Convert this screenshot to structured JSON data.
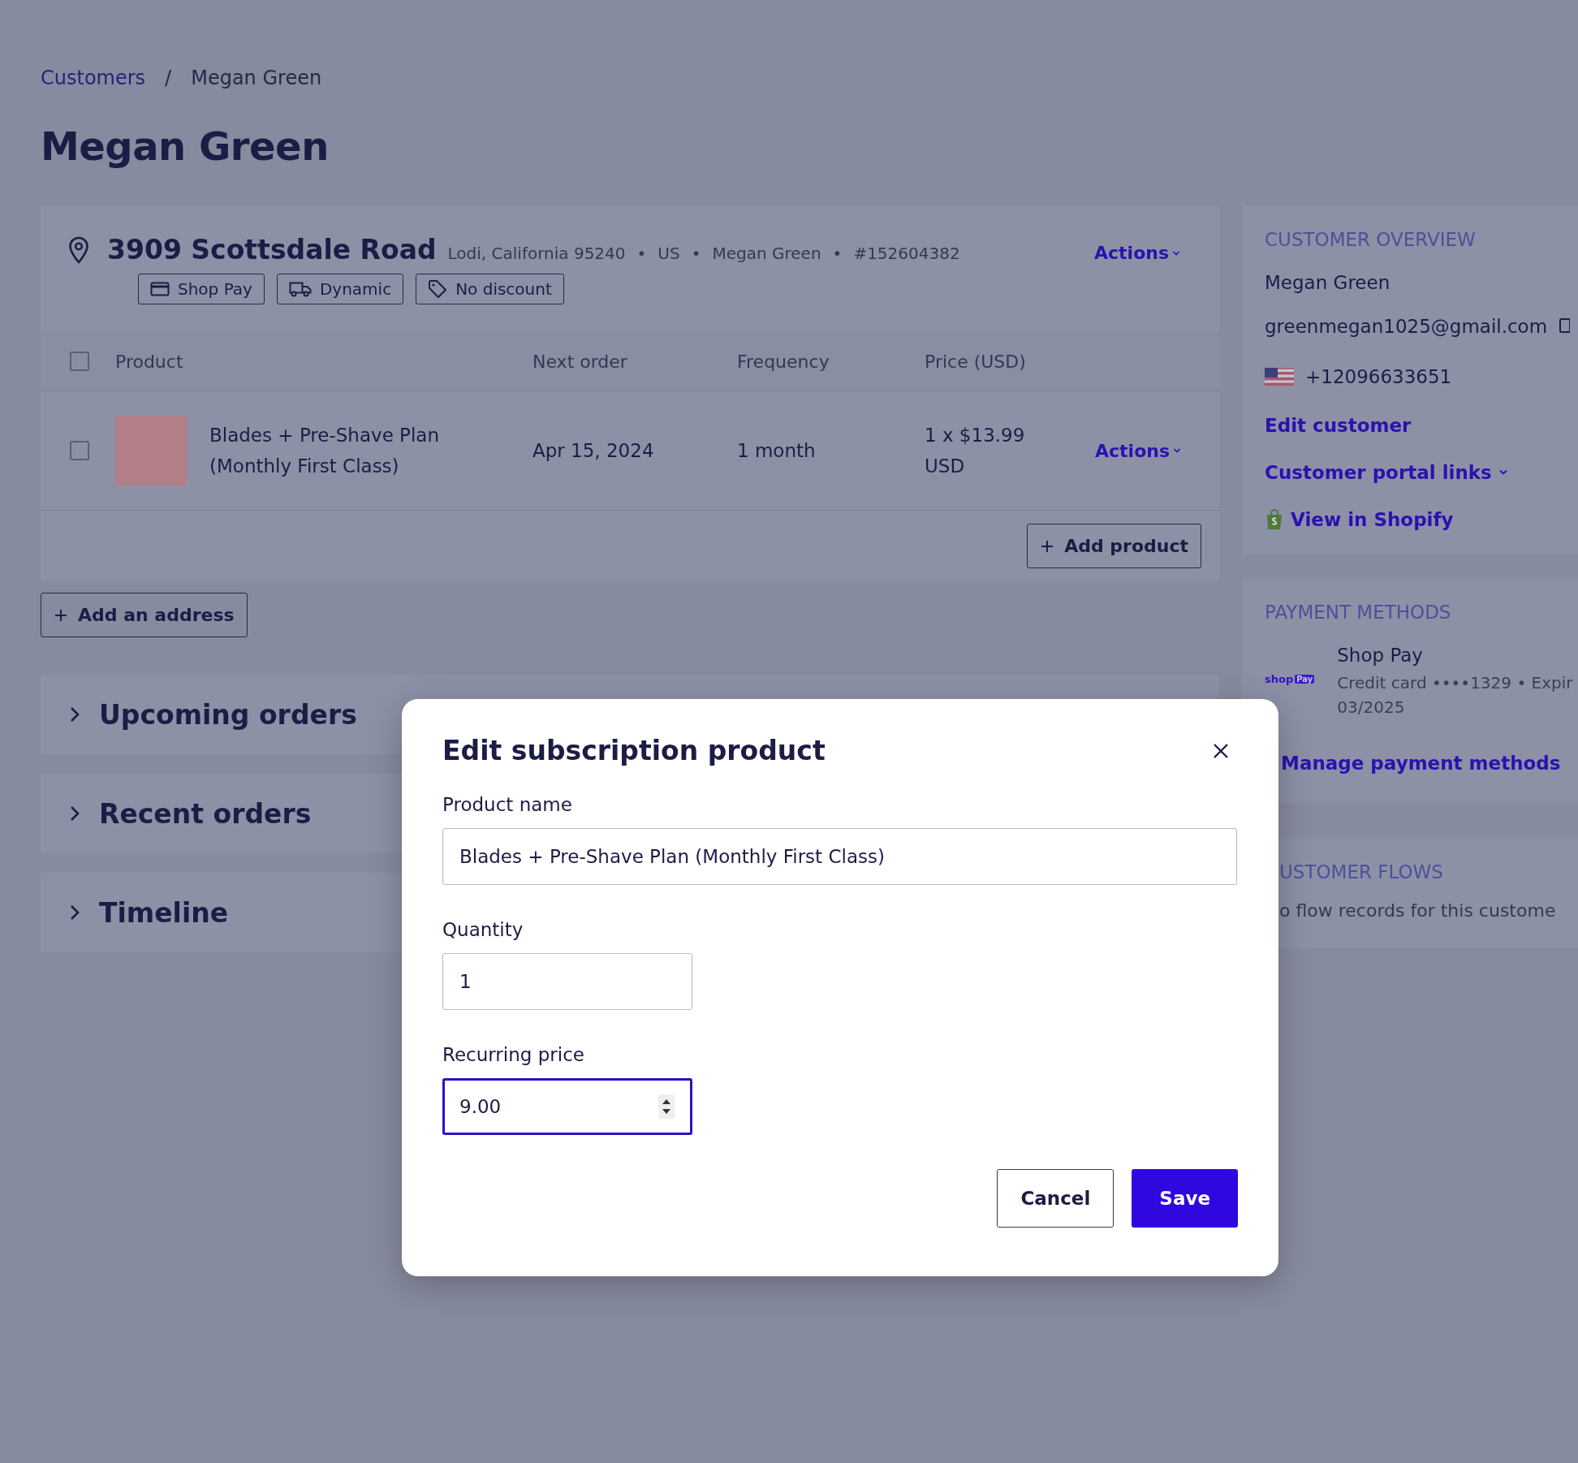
{
  "breadcrumb": [
    {
      "label": "Customers",
      "kind": "link"
    },
    {
      "label": "Megan Green",
      "kind": "current"
    }
  ],
  "breadcrumb_separator": "/",
  "page_title": "Megan Green",
  "address_card": {
    "street": "3909 Scottsdale Road",
    "details": [
      "Lodi, California 95240",
      "US",
      "Megan Green",
      "#152604382"
    ],
    "detail_separator": "•",
    "actions": "Actions",
    "tags": [
      {
        "label": "Shop Pay",
        "kind": "card"
      },
      {
        "label": "Dynamic",
        "kind": "truck"
      },
      {
        "label": "No discount",
        "kind": "tag"
      }
    ],
    "table": {
      "columns": [
        "Product",
        "Next order",
        "Frequency",
        "Price (USD)"
      ],
      "header_checked": false,
      "rows": [
        {
          "checked": false,
          "product": "Blades + Pre-Shave Plan (Monthly First Class)",
          "next_order": "Apr 15, 2024",
          "frequency": "1 month",
          "price": "1 x $13.99 USD",
          "actions": "Actions"
        }
      ]
    },
    "add_product": "Add product"
  },
  "add_address": "Add an address",
  "sections": [
    {
      "title": "Upcoming orders",
      "expanded": false
    },
    {
      "title": "Recent orders",
      "expanded": false
    },
    {
      "title": "Timeline",
      "expanded": false
    }
  ],
  "customer_overview": {
    "heading": "CUSTOMER OVERVIEW",
    "name": "Megan Green",
    "email": "greenmegan1025@gmail.com",
    "phone": "+12096633651",
    "links": [
      {
        "label": "Edit customer",
        "kind": "plain"
      },
      {
        "label": "Customer portal links",
        "kind": "dropdown"
      },
      {
        "label": "View in Shopify",
        "kind": "shopify"
      }
    ]
  },
  "payment_methods": {
    "heading": "PAYMENT METHODS",
    "logo_text": [
      "shop",
      "Pay"
    ],
    "method": "Shop Pay",
    "detail": "Credit card ••••1329 • Expir",
    "expiry": "03/2025",
    "manage": "Manage payment methods"
  },
  "customer_flows": {
    "heading": "USTOMER FLOWS",
    "empty": "o flow records for this custome"
  },
  "modal": {
    "title": "Edit subscription product",
    "fields": [
      {
        "label": "Product name",
        "value": "Blades + Pre-Shave Plan (Monthly First Class)",
        "kind": "text",
        "focused": false
      },
      {
        "label": "Quantity",
        "value": "1",
        "kind": "text",
        "focused": false
      },
      {
        "label": "Recurring price",
        "value": "9.00",
        "kind": "number",
        "focused": true
      }
    ],
    "buttons": [
      {
        "label": "Cancel",
        "kind": "secondary"
      },
      {
        "label": "Save",
        "kind": "primary"
      }
    ]
  }
}
